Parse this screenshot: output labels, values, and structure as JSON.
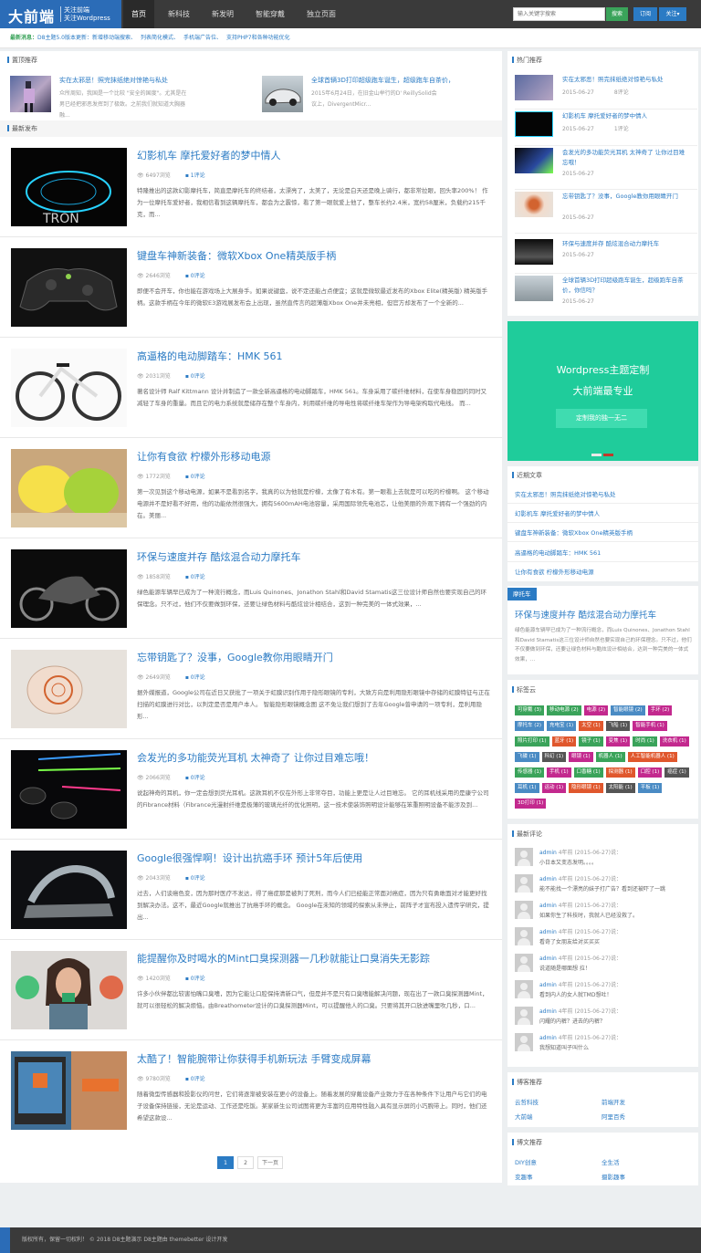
{
  "header": {
    "logo_main": "大前端",
    "logo_sub1": "关注前端",
    "logo_sub2": "关注Wordpress",
    "nav": [
      "首页",
      "新科技",
      "新发明",
      "智能穿戴",
      "独立页面"
    ],
    "search_placeholder": "输入关键字搜索",
    "search_btn": "搜索",
    "subscribe_btn": "订阅",
    "follow_btn": "关注▾"
  },
  "notice": {
    "label": "最新消息：",
    "items": [
      "D8主题5.0版本更新：新增移动端搜索、",
      "列表简化模式、",
      "手机端广告位、",
      "支持PHP7和各种功能优化"
    ]
  },
  "pinned": {
    "title": "置顶推荐",
    "items": [
      {
        "title": "实在太邪恶！照完抹纸绝对惊艳与私处",
        "excerpt": "众所周知，我国是一个比较 \"安全的国度\"。尤其是在男已经把邪恶发挥到了极致。之前我们就知道大胸器融..."
      },
      {
        "title": "全球首辆3D打印超级跑车诞生，超级跑车自茶价，",
        "excerpt": "2015年6月24日，在旧金山举行的D' ReillySolid会议上，DivergentMicr..."
      }
    ]
  },
  "latest": {
    "title": "最新发布",
    "posts": [
      {
        "title": "幻影机车 摩托爱好者的梦中情人",
        "views": "6497浏览",
        "comments": "1评论",
        "excerpt": "特隆推出的这款幻影摩托车，简直是摩托车的终结者，太漂亮了，太美了，无论是白天还是晚上骑行，都非常拉眼，回头率200%！ 作为一位摩托车爱好者，我相信看到这辆摩托车，都会为之震惊，看了第一眼就爱上他了，整车长约2.4米，宽约58厘米，负载约215千克，而..."
      },
      {
        "title": "键盘车神新装备：微软Xbox One精英版手柄",
        "views": "2646浏览",
        "comments": "0评论",
        "excerpt": "即便不会开车，你也能在游戏场上大展身手。如果说键盘，说不定还能占点便宜；这就是微软最近发布的Xbox Elite(精英版) 精英版手柄。这款手柄在今年的微软E3游戏展发布会上出现，虽然直传言的超薄版Xbox One并未亮相，但官方却发布了一个全新的..."
      },
      {
        "title": "高逼格的电动脚踏车：HMK 561",
        "views": "2031浏览",
        "comments": "0评论",
        "excerpt": "著名设计师 Ralf Kittmann 设计并制造了一款全新高逼格的电动脚踏车，HMK 561。车身采用了碳纤维材料，在使车身稳固的同时又减轻了车身的重量。而且它的电力系统就是储存在整个车身内，利用碳纤维的导电性将碳纤维车架作为导电架构取代电线。 而..."
      },
      {
        "title": "让你有食欲 柠檬外形移动电源",
        "views": "1772浏览",
        "comments": "0评论",
        "excerpt": "第一次见到这个移动电源，如果不是看到名字，我真的以为他就是柠檬，太像了有木有。第一眼看上去就是可以吃的柠檬啊。 这个移动电源并不是好看不好用，他的功能依然很强大，拥有5600mAH电池容量，采用国际领先电池芯，让他美丽的外观下拥有一个强劲的内在。美丽..."
      },
      {
        "title": "环保与速度并存 酷炫混合动力摩托车",
        "views": "1858浏览",
        "comments": "0评论",
        "excerpt": "绿色能源车辆早已成为了一种流行概念，而Luis Quinones、Jonathon Stahl和David Stamatis这三位设计师自然也要实现自己的环保理念。只不过，他们不仅要做到环保，还要让绿色材料与酷炫设计相结合，这到一种完美的一体式效果，..."
      },
      {
        "title": "忘带钥匙了？没事，Google教你用眼睛开门",
        "views": "2649浏览",
        "comments": "0评论",
        "excerpt": "据外媒报道，Google公司在近日又获批了一项关于虹膜识别作用于隐形眼镜的专利，大致方向是利用隐形眼镜中存储的虹膜特征与正在扫描的虹膜进行对比，以判定是否是用户本人。 智能隐形眼镜概念图 这不免让我们想到了去年Google曾申请的一项专利，是利用隐形..."
      },
      {
        "title": "会发光的多功能荧光耳机 太神奇了 让你过目难忘哦！",
        "views": "2066浏览",
        "comments": "0评论",
        "excerpt": "说起神奇的耳机，你一定会想到荧光耳机。这款耳机不仅在外形上非常夺目，功能上更是让人过目难忘。 它的耳机线采用的是康宁公司的Fibrance材料（Fibrance光漫射纤维是极薄的玻璃光纤的优化照明，这一技术使装饰照明设计能够在笨重照明设备不能涉及到..."
      },
      {
        "title": "Google很强悍啊！设计出抗癌手环 预计5年后使用",
        "views": "2043浏览",
        "comments": "0评论",
        "excerpt": "过去，人们谈癌色变，因为那时医疗不发达，得了癌症那是被判了死刑，而今人们已经能正常面对癌症，因为只有勇敢面对才能更好找到解决办法。这不，最近Google就推出了抗癌手环的概念。 Google在未知的领域的探索从未停止，前阵子才宣布投入遗传学研究，提出..."
      },
      {
        "title": "能提醒你及时喝水的Mint口臭探测器一几秒就能让口臭消失无影踪",
        "views": "1420浏览",
        "comments": "0评论",
        "excerpt": "许多小伙伴都比较害怕嘴口臭嗜，因为它能让口腔保持清新口气，但是并不是只有口臭嗜能解决问题，现在出了一款口臭探测器Mint，就可以很轻松的解决烦恼。由Breathometer设计的口臭探测器Mint，可以提醒他人的口臭。只要将其开口放进嘴里吹几秒，口..."
      },
      {
        "title": "太酷了！智能腕带让你获得手机新玩法 手臂变成屏幕",
        "views": "9780浏览",
        "comments": "0评论",
        "excerpt": "随着微型传感器和投影仪的问世，它们将逐渐被安装在更小的设备上。随着发展的穿戴设备产业致力于在各种条件下让用户与它们的电子设备保持链接，无论是运动、工作还是吃饭。某家新生公司试图将更为丰富的应用特性融入具有显示屏的小巧腕带上。同时，他们还希望这款设..."
      }
    ],
    "pager": [
      "1",
      "2",
      "下一页"
    ]
  },
  "hot": {
    "title": "热门推荐",
    "items": [
      {
        "title": "实在太邪恶！照完抹纸绝对惊艳与私处",
        "date": "2015-06-27",
        "comments": "8评论"
      },
      {
        "title": "幻影机车 摩托爱好者的梦中情人",
        "date": "2015-06-27",
        "comments": "1评论"
      },
      {
        "title": "会发光的多功能荧光耳机 太神奇了 让你过目难忘哦！",
        "date": "2015-06-27",
        "comments": ""
      },
      {
        "title": "忘带钥匙了？没事，Google教你用眼睛开门",
        "date": "2015-06-27",
        "comments": ""
      },
      {
        "title": "环保与速度并存 酷炫混合动力摩托车",
        "date": "2015-06-27",
        "comments": ""
      },
      {
        "title": "全球首辆3D打印超级跑车诞生，超级跑车自茶价，你信吗？",
        "date": "2015-06-27",
        "comments": ""
      }
    ]
  },
  "banner": {
    "line1": "Wordpress主题定制",
    "line2": "大前端最专业",
    "button": "定制我的独一无二"
  },
  "recent": {
    "title": "近期文章",
    "items": [
      "实在太邪恶！照完抹纸绝对惊艳与私处",
      "幻影机车 摩托爱好者的梦中情人",
      "键盘车神新装备：微软Xbox One精英版手柄",
      "高逼格的电动脚踏车：HMK 561",
      "让你有食欲 柠檬外形移动电源"
    ]
  },
  "feature": {
    "badge": "摩托车",
    "title": "环保与速度并存 酷炫混合动力摩托车",
    "excerpt": "绿色能源车辆早已成为了一种流行概念，而Luis Quinones、Jonathon Stahl和David Stamatis这三位设计师自然也要实现自己的环保理念。只不过，他们不仅要做到环保，还要让绿色材料与酷炫设计相结合，达到一种完美的一体式效果，..."
  },
  "tags": {
    "title": "标签云",
    "items": [
      {
        "t": "可穿戴 (3)",
        "c": "#3aa35a"
      },
      {
        "t": "移动电源 (2)",
        "c": "#3aa35a"
      },
      {
        "t": "电源 (2)",
        "c": "#c3298e"
      },
      {
        "t": "智能眼镜 (2)",
        "c": "#4a8bc4"
      },
      {
        "t": "手环 (2)",
        "c": "#c3298e"
      },
      {
        "t": "摩托车 (2)",
        "c": "#4a8bc4"
      },
      {
        "t": "充电宝 (1)",
        "c": "#4a8bc4"
      },
      {
        "t": "太空 (1)",
        "c": "#e0572d"
      },
      {
        "t": "飞船 (1)",
        "c": "#555"
      },
      {
        "t": "智能手机 (1)",
        "c": "#c3298e"
      },
      {
        "t": "照片打印 (1)",
        "c": "#3aa35a"
      },
      {
        "t": "蓝牙 (1)",
        "c": "#e0572d"
      },
      {
        "t": "镜子 (1)",
        "c": "#3aa35a"
      },
      {
        "t": "变焦 (1)",
        "c": "#c3298e"
      },
      {
        "t": "时尚 (1)",
        "c": "#3aa35a"
      },
      {
        "t": "洗衣机 (1)",
        "c": "#c3298e"
      },
      {
        "t": "飞碟 (1)",
        "c": "#4a8bc4"
      },
      {
        "t": "科幻 (1)",
        "c": "#555"
      },
      {
        "t": "眼镜 (1)",
        "c": "#c3298e"
      },
      {
        "t": "机器人 (1)",
        "c": "#3aa35a"
      },
      {
        "t": "人工智能机器人 (1)",
        "c": "#e0572d"
      },
      {
        "t": "传感器 (1)",
        "c": "#3aa35a"
      },
      {
        "t": "手机 (1)",
        "c": "#c3298e"
      },
      {
        "t": "口香糖 (1)",
        "c": "#3aa35a"
      },
      {
        "t": "探测器 (1)",
        "c": "#e0572d"
      },
      {
        "t": "口腔 (1)",
        "c": "#c3298e"
      },
      {
        "t": "癌症 (1)",
        "c": "#555"
      },
      {
        "t": "耳机 (1)",
        "c": "#4a8bc4"
      },
      {
        "t": "运动 (1)",
        "c": "#c3298e"
      },
      {
        "t": "隐形眼镜 (1)",
        "c": "#e0572d"
      },
      {
        "t": "太阳能 (1)",
        "c": "#555"
      },
      {
        "t": "平板 (1)",
        "c": "#4a8bc4"
      },
      {
        "t": "3D打印 (1)",
        "c": "#c3298e"
      }
    ]
  },
  "comments": {
    "title": "最新评论",
    "items": [
      {
        "user": "admin",
        "time": "4年前 (2015-06-27)说：",
        "text": "小日本又变态发明。。。。"
      },
      {
        "user": "admin",
        "time": "4年前 (2015-06-27)说：",
        "text": "能不能找一个漂亮的妹子打广告？看到还被吓了一跳"
      },
      {
        "user": "admin",
        "time": "4年前 (2015-06-27)说：",
        "text": "如果你生了科技时，我就人已经没救了。"
      },
      {
        "user": "admin",
        "time": "4年前 (2015-06-27)说：",
        "text": "看奇了女朋友给对买买买"
      },
      {
        "user": "admin",
        "time": "4年前 (2015-06-27)说：",
        "text": "说道随是哪面想 拉！"
      },
      {
        "user": "admin",
        "time": "4年前 (2015-06-27)说：",
        "text": "看到内人的女人就TMD想吐！"
      },
      {
        "user": "admin",
        "time": "4年前 (2015-06-27)说：",
        "text": "闪耀的内裤？进去的内裤？"
      },
      {
        "user": "admin",
        "time": "4年前 (2015-06-27)说：",
        "text": "我想知道叫子叫什么"
      }
    ]
  },
  "blogroll": {
    "title": "博客推荐",
    "items": [
      "云哲科技",
      "前端开发",
      "大前端",
      "阿里百秀"
    ]
  },
  "posts_rec": {
    "title": "博文推荐",
    "items": [
      "DIY创意",
      "全生活",
      "变趣事",
      "摄影趣事"
    ]
  },
  "footer": {
    "text": "版权所有，保留一切权利！ © 2018 D8主题演示   D8主题由 themebetter 设计开发"
  }
}
